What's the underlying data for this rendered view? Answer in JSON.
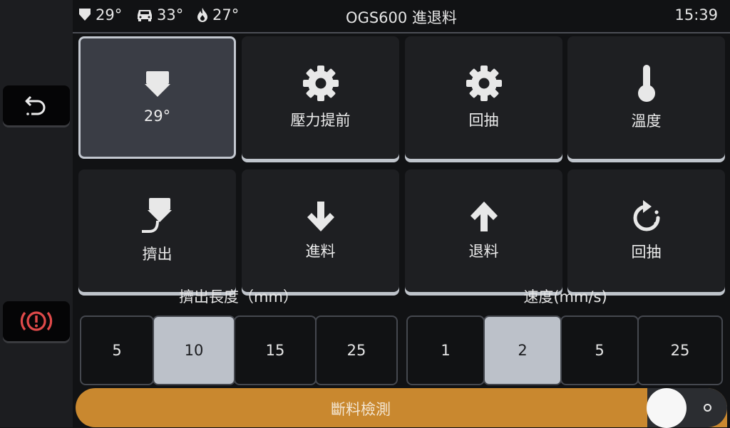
{
  "header": {
    "title": "OGS600 進退料",
    "clock": "15:39",
    "status": [
      {
        "icon": "extruder-icon",
        "value": "29°"
      },
      {
        "icon": "bed-icon",
        "value": "33°"
      },
      {
        "icon": "flame-icon",
        "value": "27°"
      }
    ]
  },
  "sidebar": {
    "back_icon": "back-arrow-icon",
    "emergency_icon": "emergency-stop-icon"
  },
  "tiles": [
    {
      "label": "29°",
      "icon": "extruder-icon",
      "active": true
    },
    {
      "label": "壓力提前",
      "icon": "gear-icon"
    },
    {
      "label": "回抽",
      "icon": "gear-icon"
    },
    {
      "label": "溫度",
      "icon": "thermometer-icon"
    },
    {
      "label": "擠出",
      "icon": "extrude-icon"
    },
    {
      "label": "進料",
      "icon": "arrow-down-icon"
    },
    {
      "label": "退料",
      "icon": "arrow-up-icon"
    },
    {
      "label": "回抽",
      "icon": "retract-icon"
    }
  ],
  "length": {
    "label": "擠出長度（mm）",
    "options": [
      "5",
      "10",
      "15",
      "25"
    ],
    "selected": "10"
  },
  "speed": {
    "label": "速度(mm/s)",
    "options": [
      "1",
      "2",
      "5",
      "25"
    ],
    "selected": "2"
  },
  "filament_sensor": {
    "label": "斷料檢測",
    "enabled": true
  },
  "colors": {
    "accent": "#c9882f",
    "background": "#111214",
    "sidebar": "#1c1d20",
    "tile": "#1e1f22",
    "selected": "#bcc1c9",
    "emergency": "#e04a4a"
  }
}
